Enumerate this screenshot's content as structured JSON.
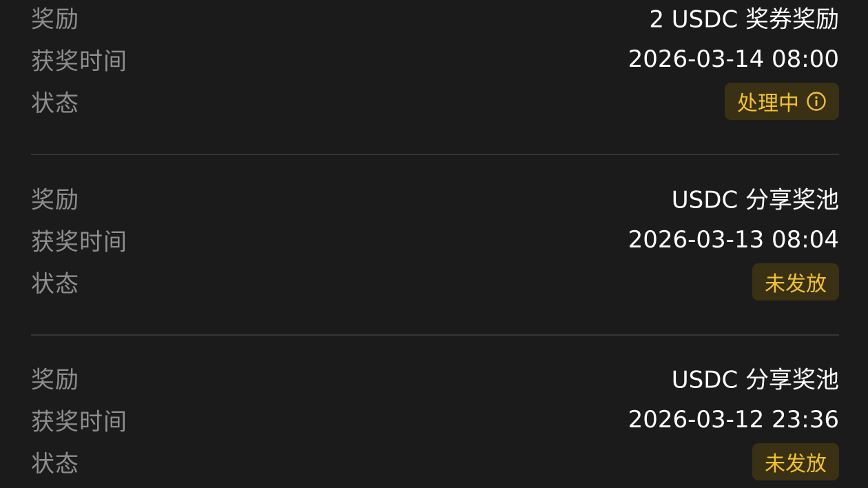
{
  "colors": {
    "background": "#1b1b1b",
    "label": "#8e8e8e",
    "value": "#ffffff",
    "badge_bg": "#3a3014",
    "badge_text": "#f2c233",
    "divider": "#353535"
  },
  "records": [
    {
      "reward_label": "奖励",
      "reward_value": "2 USDC 奖券奖励",
      "time_label": "获奖时间",
      "time_value": "2026-03-14 08:00",
      "status_label": "状态",
      "status_value": "处理中",
      "status_icon": "info-icon"
    },
    {
      "reward_label": "奖励",
      "reward_value": "USDC 分享奖池",
      "time_label": "获奖时间",
      "time_value": "2026-03-13 08:04",
      "status_label": "状态",
      "status_value": "未发放"
    },
    {
      "reward_label": "奖励",
      "reward_value": "USDC 分享奖池",
      "time_label": "获奖时间",
      "time_value": "2026-03-12 23:36",
      "status_label": "状态",
      "status_value": "未发放"
    }
  ]
}
